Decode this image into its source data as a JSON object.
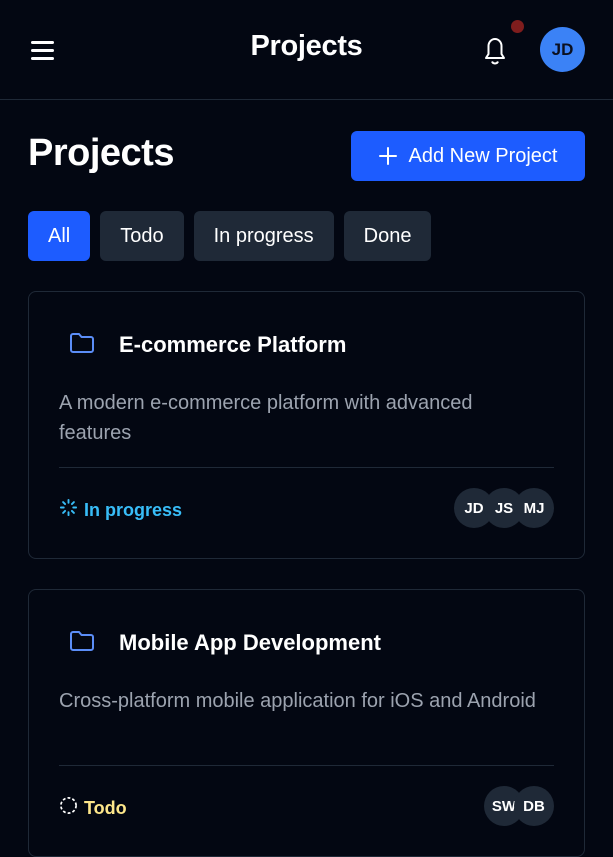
{
  "header": {
    "title": "Projects",
    "avatar_initials": "JD"
  },
  "page": {
    "title": "Projects",
    "add_button_label": "Add New Project"
  },
  "filters": [
    "All",
    "Todo",
    "In progress",
    "Done"
  ],
  "projects": [
    {
      "title": "E-commerce Platform",
      "description": "A modern e-commerce platform with advanced features",
      "status": "In progress",
      "status_color": "#38bdf8",
      "members": [
        "JD",
        "JS",
        "MJ"
      ]
    },
    {
      "title": "Mobile App Development",
      "description": "Cross-platform mobile application for iOS and Android",
      "status": "Todo",
      "status_color": "#fde68a",
      "members": [
        "SW",
        "DB"
      ]
    }
  ],
  "colors": {
    "accent": "#1d5cff",
    "background": "#030712",
    "notification_dot": "#7f1d1d"
  }
}
